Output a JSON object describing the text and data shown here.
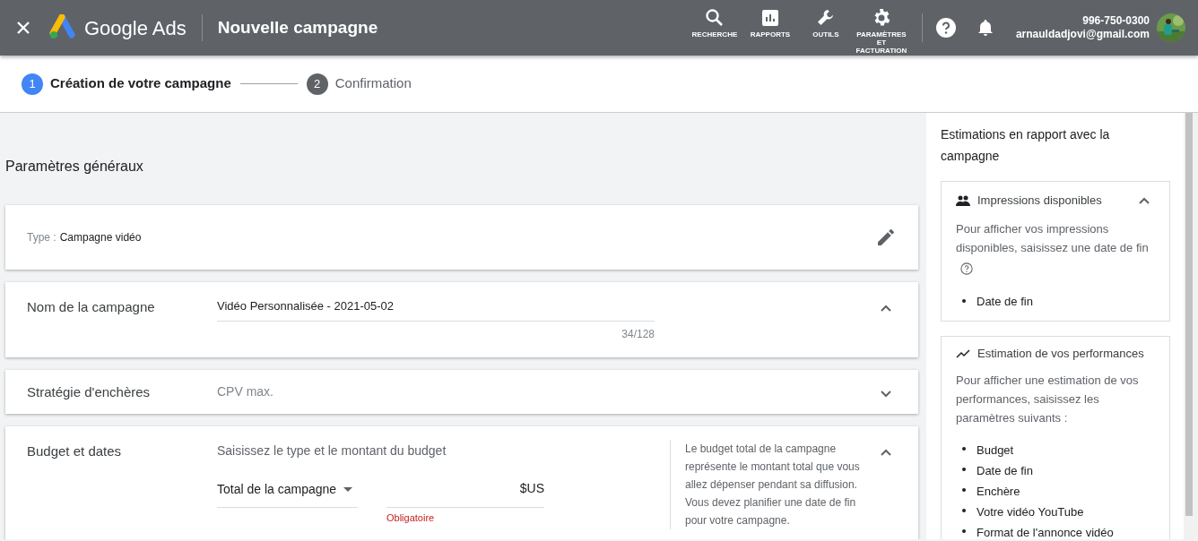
{
  "header": {
    "brand": "Google Ads",
    "title": "Nouvelle campagne",
    "tools": [
      {
        "kind": "search",
        "label": "RECHERCHE"
      },
      {
        "kind": "reports",
        "label": "RAPPORTS"
      },
      {
        "kind": "tools",
        "label": "OUTILS"
      },
      {
        "kind": "settings",
        "label": "PARAMÈTRES ET FACTURATION"
      }
    ],
    "account": {
      "phone": "996-750-0300",
      "email": "arnauldadjovi@gmail.com"
    }
  },
  "steps": [
    {
      "number": "1",
      "label": "Création de votre campagne",
      "selected": true
    },
    {
      "number": "2",
      "label": "Confirmation",
      "selected": false
    }
  ],
  "section_title": "Paramètres généraux",
  "type_card": {
    "label": "Type :",
    "value": "Campagne vidéo"
  },
  "sections": [
    {
      "kind": "name",
      "label": "Nom de la campagne",
      "expanded": true,
      "value": "Vidéo Personnalisée - 2021-05-02",
      "counter": "34/128"
    },
    {
      "kind": "summary",
      "label": "Stratégie d'enchères",
      "expanded": false,
      "value": "CPV max."
    },
    {
      "kind": "budget",
      "label": "Budget et dates",
      "expanded": true,
      "hint": "Saisissez le type et le montant du budget",
      "budget_type": "Total de la campagne",
      "currency": "$US",
      "error": "Obligatoire",
      "help": "Le budget total de la campagne représente le montant total que vous allez dépenser pendant sa diffusion. Vous devez planifier une date de fin pour votre campagne."
    }
  ],
  "sidebar": {
    "title": "Estimations en rapport avec la campagne",
    "cards": [
      {
        "kind": "people",
        "title": "Impressions disponibles",
        "expanded": true,
        "text": "Pour afficher vos impressions disponibles, saisissez une date de fin",
        "help": true,
        "items": [
          "Date de fin"
        ]
      },
      {
        "kind": "trend",
        "title": "Estimation de vos performances",
        "text": "Pour afficher une estimation de vos performances, saisissez les paramètres suivants :",
        "help": false,
        "items": [
          "Budget",
          "Date de fin",
          "Enchère",
          "Votre vidéo YouTube",
          "Format de l'annonce vidéo"
        ]
      }
    ]
  }
}
